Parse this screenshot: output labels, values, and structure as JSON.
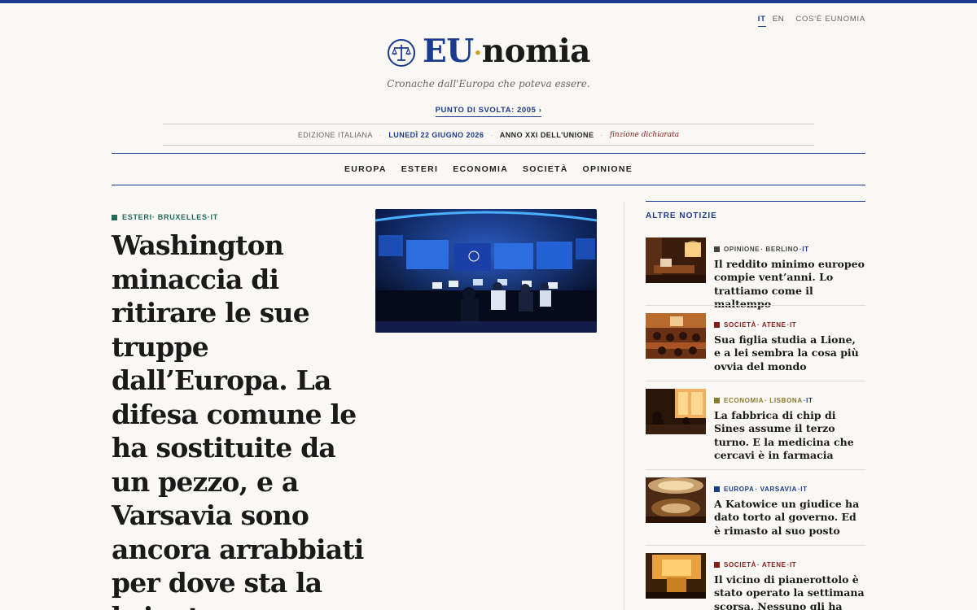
{
  "lang": {
    "it": "IT",
    "en": "EN",
    "about": "COS'È EUNOMIA"
  },
  "logo": {
    "eu": "EU",
    "dot": "·",
    "nomia": "nomia"
  },
  "tagline": "Cronache dall'Europa che poteva essere.",
  "turning_point": "PUNTO DI SVOLTA: 2005 ›",
  "edition": {
    "name": "EDIZIONE ITALIANA",
    "date": "LUNEDÌ 22 GIUGNO 2026",
    "year": "ANNO XXI DELL'UNIONE",
    "note": "finzione dichiarata"
  },
  "nav": [
    "EUROPA",
    "ESTERI",
    "ECONOMIA",
    "SOCIETÀ",
    "OPINIONE"
  ],
  "lead": {
    "cat": "ESTERI",
    "place": "· BRUXELLES",
    "lang": "·IT",
    "cat_color": "#1f6b5a",
    "title": "Washington minaccia di ritirare le sue truppe dall’Europa. La difesa comune le ha sostituite da un pezzo, e a Varsavia sono ancora arrabbiati per dove sta la brigata"
  },
  "sidebar": {
    "heading": "ALTRE NOTIZIE",
    "items": [
      {
        "cat": "OPINIONE",
        "place": "· BERLINO",
        "lang": "·IT",
        "color": "#444444",
        "title": "Il reddito minimo europeo compie vent’anni. Lo trattiamo come il maltempo"
      },
      {
        "cat": "SOCIETÀ",
        "place": "· ATENE",
        "lang": "·IT",
        "color": "#8b1a1a",
        "title": "Sua figlia studia a Lione, e a lei sembra la cosa più ovvia del mondo"
      },
      {
        "cat": "ECONOMIA",
        "place": "· LISBONA",
        "lang": "·IT",
        "color": "#8a7a2a",
        "title": "La fabbrica di chip di Sines assume il terzo turno. E la medicina che cercavi è in farmacia"
      },
      {
        "cat": "EUROPA",
        "place": "· VARSAVIA",
        "lang": "·IT",
        "color": "#1a3a8f",
        "title": "A Katowice un giudice ha dato torto al governo. Ed è rimasto al suo posto"
      },
      {
        "cat": "SOCIETÀ",
        "place": "· ATENE",
        "lang": "·IT",
        "color": "#8b1a1a",
        "title": "Il vicino di pianerottolo è stato operato la settimana scorsa. Nessuno gli ha chiesto la carta di credito"
      }
    ]
  }
}
